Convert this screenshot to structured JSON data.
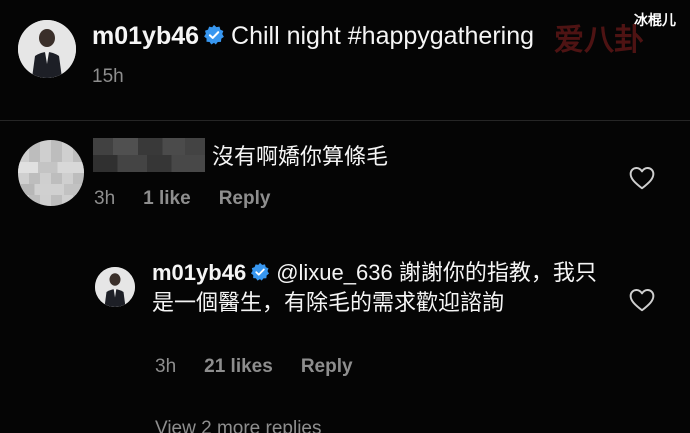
{
  "post": {
    "username": "m01yb46",
    "caption": "Chill night #happygathering",
    "time": "15h"
  },
  "comment": {
    "text": "沒有啊嬌你算條毛",
    "time": "3h",
    "likes": "1 like",
    "reply_label": "Reply"
  },
  "reply": {
    "username": "m01yb46",
    "text": "@lixue_636 謝謝你的指教，我只是一個醫生，有除毛的需求歡迎諮詢",
    "time": "3h",
    "likes": "21 likes",
    "reply_label": "Reply"
  },
  "view_more": "View 2 more replies",
  "watermark": {
    "corner_text": "冰棍儿",
    "logo_text": "爱八卦"
  },
  "colors": {
    "background": "#050505",
    "text": "#f5f5f5",
    "muted": "#8e8e8e",
    "verified": "#3897f0"
  }
}
